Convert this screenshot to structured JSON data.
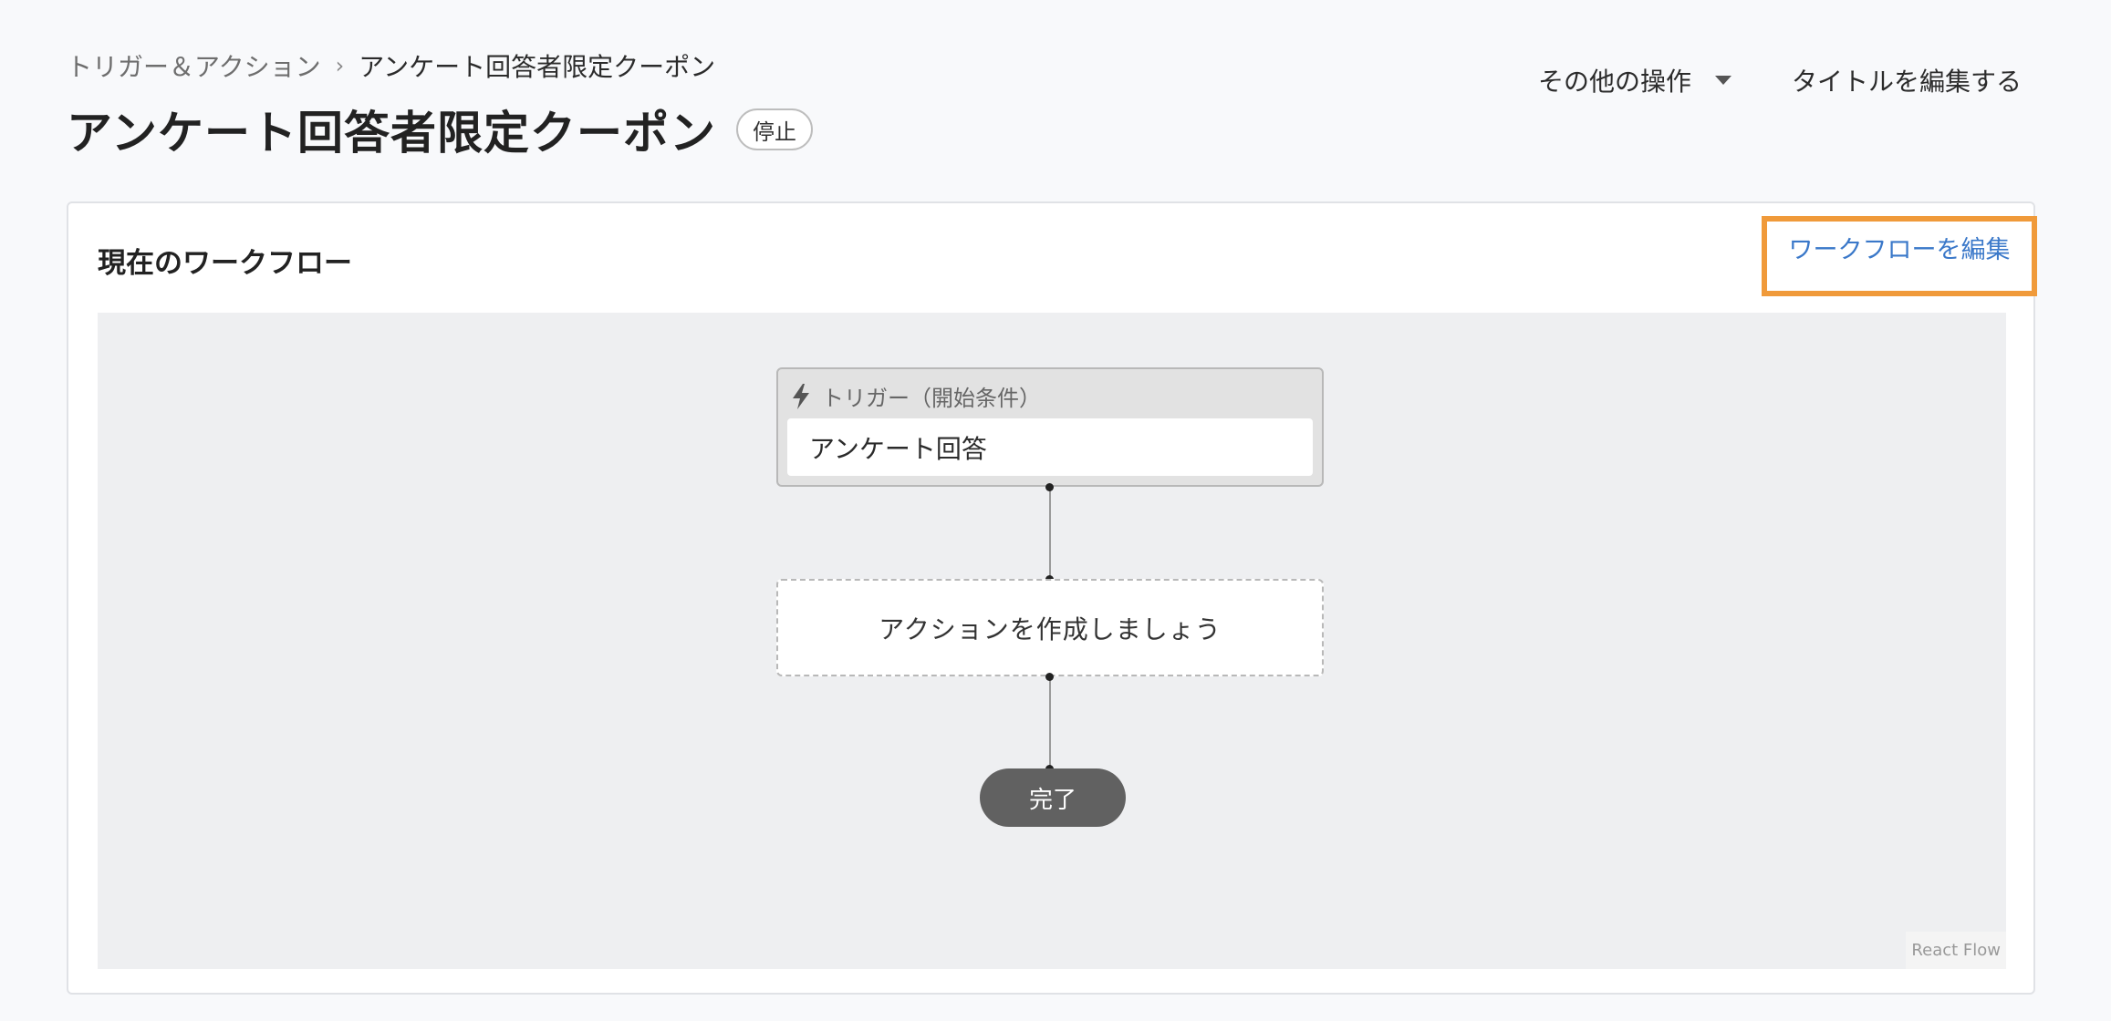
{
  "breadcrumb": {
    "parent": "トリガー＆アクション",
    "separator": "›",
    "current": "アンケート回答者限定クーポン"
  },
  "page": {
    "title": "アンケート回答者限定クーポン",
    "status": "停止"
  },
  "header_actions": {
    "more": "その他の操作",
    "edit_title": "タイトルを編集する"
  },
  "workflow_card": {
    "title": "現在のワークフロー",
    "edit_link": "ワークフローを編集",
    "trigger": {
      "header": "トリガー（開始条件）",
      "value": "アンケート回答"
    },
    "action_placeholder": "アクションを作成しましょう",
    "end_label": "完了",
    "attribution": "React Flow"
  },
  "colors": {
    "accent_link": "#3a78c9",
    "highlight_border": "#f09a3a",
    "end_node": "#616161",
    "flow_background": "#eeeff1"
  }
}
